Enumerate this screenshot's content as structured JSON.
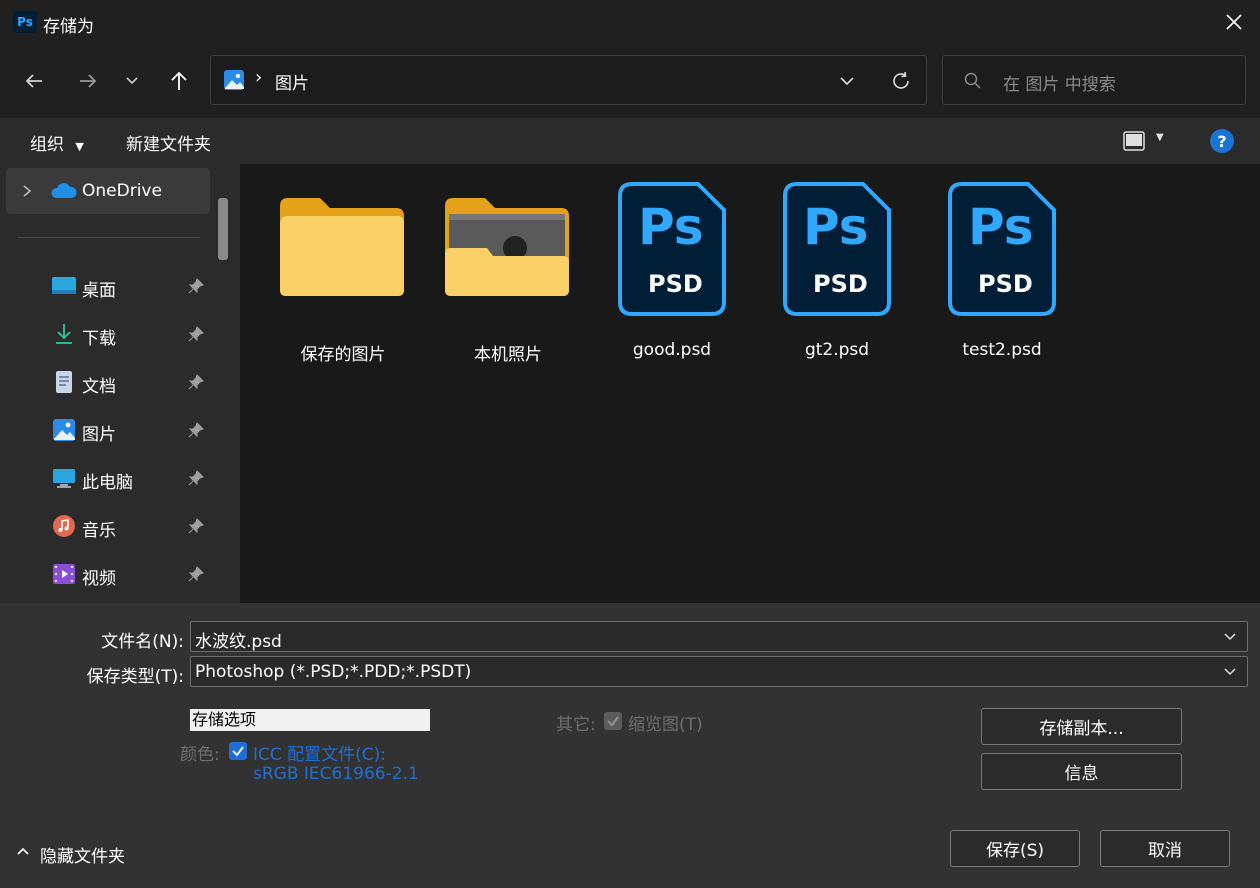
{
  "window": {
    "title": "存储为",
    "app_icon": "Ps"
  },
  "nav": {
    "back_icon": "arrow-left-icon",
    "forward_icon": "arrow-right-icon",
    "recent_icon": "chevron-down-icon",
    "up_icon": "arrow-up-icon",
    "address_separator": "›",
    "address_location": "图片",
    "search_placeholder": "在 图片 中搜索"
  },
  "toolbar": {
    "organize": "组织",
    "new_folder": "新建文件夹",
    "help": "?"
  },
  "sidebar": {
    "onedrive": "OneDrive",
    "items": [
      {
        "label": "桌面",
        "icon": "desktop-icon"
      },
      {
        "label": "下载",
        "icon": "download-icon"
      },
      {
        "label": "文档",
        "icon": "document-icon"
      },
      {
        "label": "图片",
        "icon": "pictures-icon"
      },
      {
        "label": "此电脑",
        "icon": "computer-icon"
      },
      {
        "label": "音乐",
        "icon": "music-icon"
      },
      {
        "label": "视频",
        "icon": "video-icon"
      }
    ]
  },
  "files": [
    {
      "name": "保存的图片",
      "type": "folder"
    },
    {
      "name": "本机照片",
      "type": "folder-photo"
    },
    {
      "name": "good.psd",
      "type": "psd"
    },
    {
      "name": "gt2.psd",
      "type": "psd"
    },
    {
      "name": "test2.psd",
      "type": "psd"
    }
  ],
  "psd_icon": {
    "big": "Ps",
    "small": "PSD"
  },
  "form": {
    "filename_label": "文件名(N):",
    "filename_value": "水波纹.psd",
    "filetype_label": "保存类型(T):",
    "filetype_value": "Photoshop (*.PSD;*.PDD;*.PSDT)",
    "options_header": "存储选项",
    "color_label": "颜色:",
    "icc_line1": "ICC 配置文件(C):",
    "icc_line2": "sRGB IEC61966-2.1",
    "other_label": "其它:",
    "thumbnail_label": "缩览图(T)",
    "save_copy_button": "存储副本...",
    "info_button": "信息",
    "hide_folders": "隐藏文件夹",
    "save_button": "保存(S)",
    "cancel_button": "取消"
  },
  "colors": {
    "accent_blue": "#1f6fd6",
    "folder_yellow": "#f6c245",
    "psd_blue": "#31a8ff",
    "psd_dark": "#001e36"
  }
}
